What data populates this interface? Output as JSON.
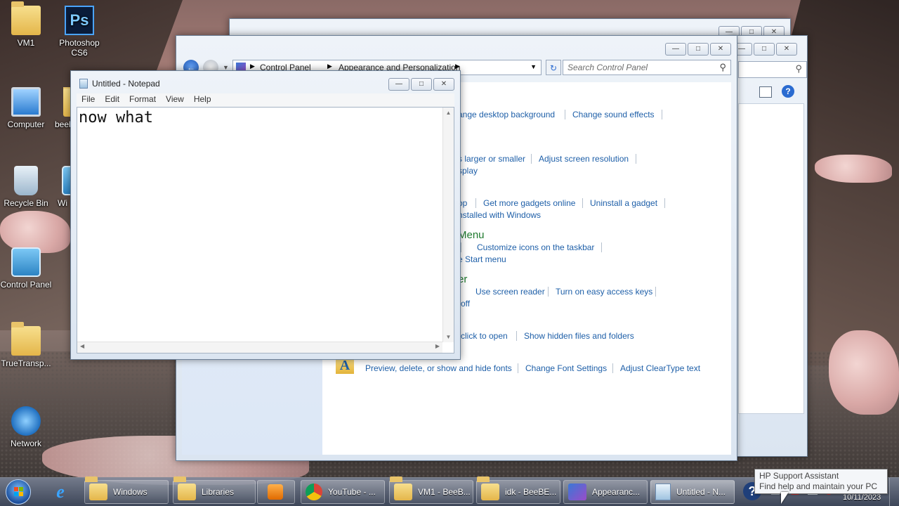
{
  "desktop": {
    "icons": [
      {
        "label": "VM1"
      },
      {
        "label": "Photoshop CS6"
      },
      {
        "label": "Computer"
      },
      {
        "label": "beeb"
      },
      {
        "label": "Recycle Bin"
      },
      {
        "label": "Wi"
      },
      {
        "label": "Control Panel"
      },
      {
        "label": "TrueTransp..."
      },
      {
        "label": "Network"
      }
    ]
  },
  "control_panel": {
    "breadcrumb": [
      "Control Panel",
      "Appearance and Personalization"
    ],
    "search_placeholder": "Search Control Panel",
    "links": {
      "desktop_bg": "ange desktop background",
      "sound": "Change sound effects",
      "text_size": "s larger or smaller",
      "resolution": "Adjust screen resolution",
      "display_partial": "splay",
      "gadgets_partial": "op",
      "more_gadgets": "Get more gadgets online",
      "uninstall_gadget": "Uninstall a gadget",
      "installed": "nstalled with Windows",
      "taskbar_icons": "Customize icons on the taskbar",
      "start_menu": "e Start menu",
      "screen_reader": "Use screen reader",
      "easy_keys": "Turn on easy access keys",
      "off_partial": "off",
      "click_open": "click to open",
      "hidden_files": "Show hidden files and folders",
      "fonts_preview": "Preview, delete, or show and hide fonts",
      "font_settings": "Change Font Settings",
      "cleartype": "Adjust ClearType text"
    },
    "headings": {
      "start_menu_partial": "Menu",
      "ease_partial": "er"
    }
  },
  "notepad": {
    "title": "Untitled - Notepad",
    "menu": [
      "File",
      "Edit",
      "Format",
      "View",
      "Help"
    ],
    "content": "now what"
  },
  "taskbar": {
    "items": [
      {
        "label": "Windows"
      },
      {
        "label": "Libraries"
      },
      {
        "label": "YouTube - ..."
      },
      {
        "label": "VM1 - BeeB..."
      },
      {
        "label": "idk - BeeBE..."
      },
      {
        "label": "Appearanc..."
      },
      {
        "label": "Untitled - N..."
      }
    ],
    "date": "10/11/2023"
  },
  "tooltip": {
    "title": "HP Support Assistant",
    "text": "Find help and maintain your PC"
  }
}
